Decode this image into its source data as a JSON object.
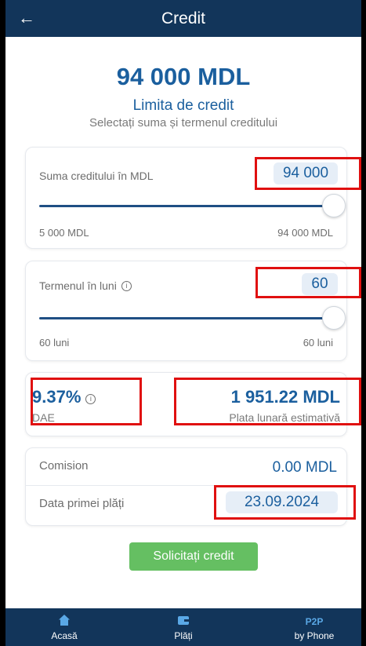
{
  "header": {
    "back_icon": "arrow-left-icon",
    "title": "Credit"
  },
  "summary": {
    "amount": "94 000 MDL",
    "limit_label": "Limita de credit",
    "subtitle": "Selectați suma și termenul creditului"
  },
  "amount_card": {
    "label": "Suma creditului în MDL",
    "value": "94 000",
    "min_label": "5 000 MDL",
    "max_label": "94 000 MDL",
    "slider_fraction": 1.0
  },
  "term_card": {
    "label": "Termenul în luni",
    "info_icon": "info-icon",
    "value": "60",
    "min_label": "60 luni",
    "max_label": "60 luni",
    "slider_fraction": 1.0
  },
  "rate_card": {
    "dae_value": "9.37%",
    "dae_label": "DAE",
    "monthly_value": "1 951.22 MDL",
    "monthly_label": "Plata lunară estimativă"
  },
  "details_card": {
    "commission_label": "Comision",
    "commission_value": "0.00 MDL",
    "first_payment_label": "Data primei plăți",
    "first_payment_value": "23.09.2024"
  },
  "apply_button": "Solicitați credit",
  "nav": {
    "home": {
      "label": "Acasă",
      "icon": "home-icon"
    },
    "payments": {
      "label": "Plăți",
      "icon": "wallet-icon"
    },
    "p2p": {
      "top": "P2P",
      "label": "by Phone"
    }
  },
  "colors": {
    "header_bg": "#12355a",
    "accent_blue": "#1b5f9e",
    "button_green": "#65bf62",
    "highlight_red": "#e01010"
  }
}
